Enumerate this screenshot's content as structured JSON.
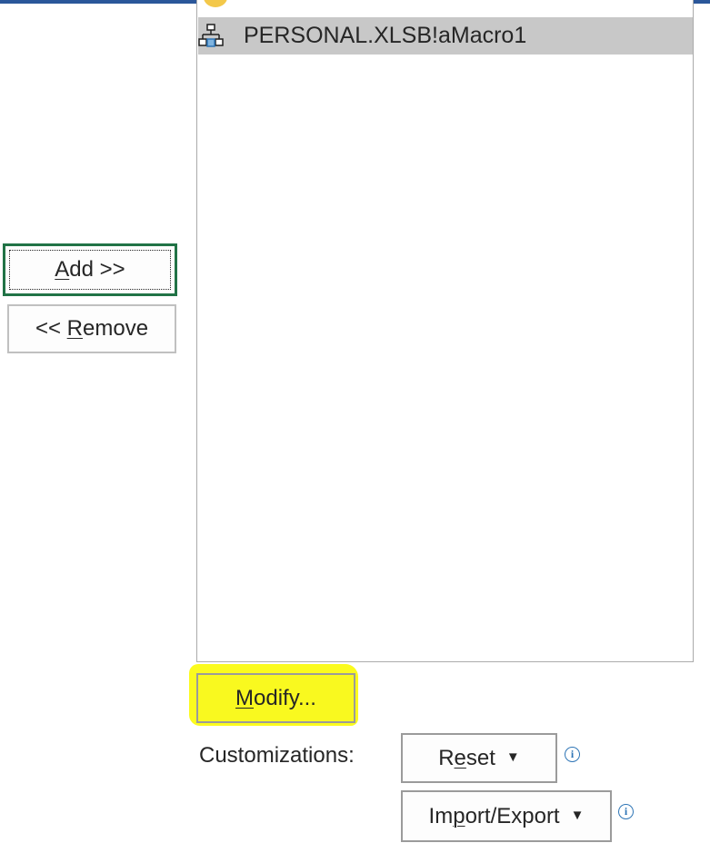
{
  "macro_list": {
    "selected_item": "PERSONAL.XLSB!aMacro1",
    "selected_item_icon": "macro-icon"
  },
  "buttons": {
    "add": {
      "mnemonic": "A",
      "rest": "dd >>"
    },
    "remove": {
      "prefix": "<< ",
      "mnemonic": "R",
      "rest": "emove"
    },
    "modify": {
      "mnemonic": "M",
      "rest": "odify..."
    },
    "reset": {
      "before": "R",
      "mnemonic": "e",
      "rest": "set"
    },
    "import_export": {
      "before": "Im",
      "mnemonic": "p",
      "rest": "ort/Export"
    }
  },
  "customizations": {
    "label": "Customizations:",
    "info_icon": "info-icon",
    "dropdown_glyph": "▼",
    "info_glyph": "i"
  },
  "colors": {
    "highlight": "#fbfb1e",
    "add_border": "#217346",
    "selected_row": "#c8c8c8",
    "info": "#2e75b6"
  }
}
